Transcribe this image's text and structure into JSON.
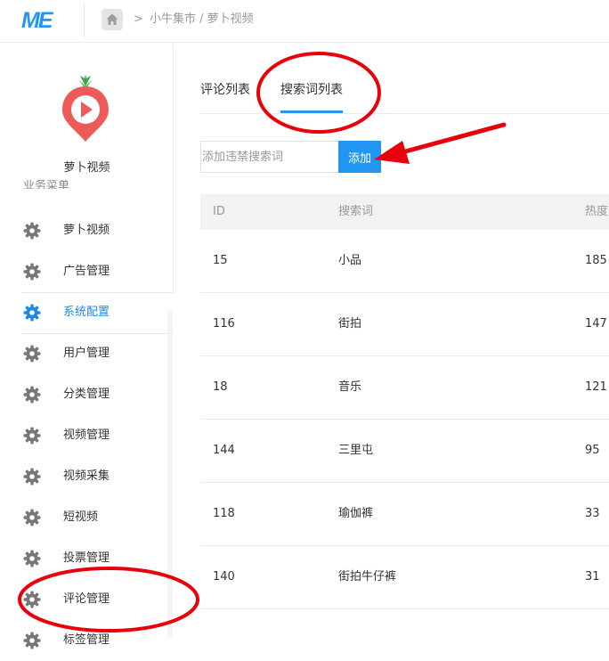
{
  "header": {
    "logo_text": "ME",
    "breadcrumb": "小牛集市 / 萝卜视频",
    "breadcrumb_sep": ">"
  },
  "sidebar": {
    "app_name": "萝卜视频",
    "group_title": "业务菜单",
    "items": [
      {
        "label": "萝卜视频"
      },
      {
        "label": "广告管理"
      },
      {
        "label": "系统配置",
        "active": true
      },
      {
        "label": "用户管理"
      },
      {
        "label": "分类管理"
      },
      {
        "label": "视频管理"
      },
      {
        "label": "视频采集"
      },
      {
        "label": "短视频"
      },
      {
        "label": "投票管理"
      },
      {
        "label": "评论管理"
      },
      {
        "label": "标签管理"
      }
    ]
  },
  "main": {
    "tabs": [
      {
        "label": "评论列表"
      },
      {
        "label": "搜索词列表",
        "active": true
      }
    ],
    "add_form": {
      "placeholder": "添加违禁搜索词",
      "button_label": "添加"
    },
    "table": {
      "columns": [
        "ID",
        "搜索词",
        "热度"
      ],
      "rows": [
        {
          "id": "15",
          "word": "小品",
          "hot": "185"
        },
        {
          "id": "116",
          "word": "街拍",
          "hot": "147"
        },
        {
          "id": "18",
          "word": "音乐",
          "hot": "121"
        },
        {
          "id": "144",
          "word": "三里屯",
          "hot": "95"
        },
        {
          "id": "118",
          "word": "瑜伽裤",
          "hot": "33"
        },
        {
          "id": "140",
          "word": "街拍牛仔裤",
          "hot": "31"
        }
      ]
    }
  },
  "colors": {
    "accent": "#2196f3",
    "active_menu": "#1e88e5",
    "annotation": "#e8000b",
    "logo_red": "#ee5a57",
    "leaf_green": "#3aa84a"
  }
}
